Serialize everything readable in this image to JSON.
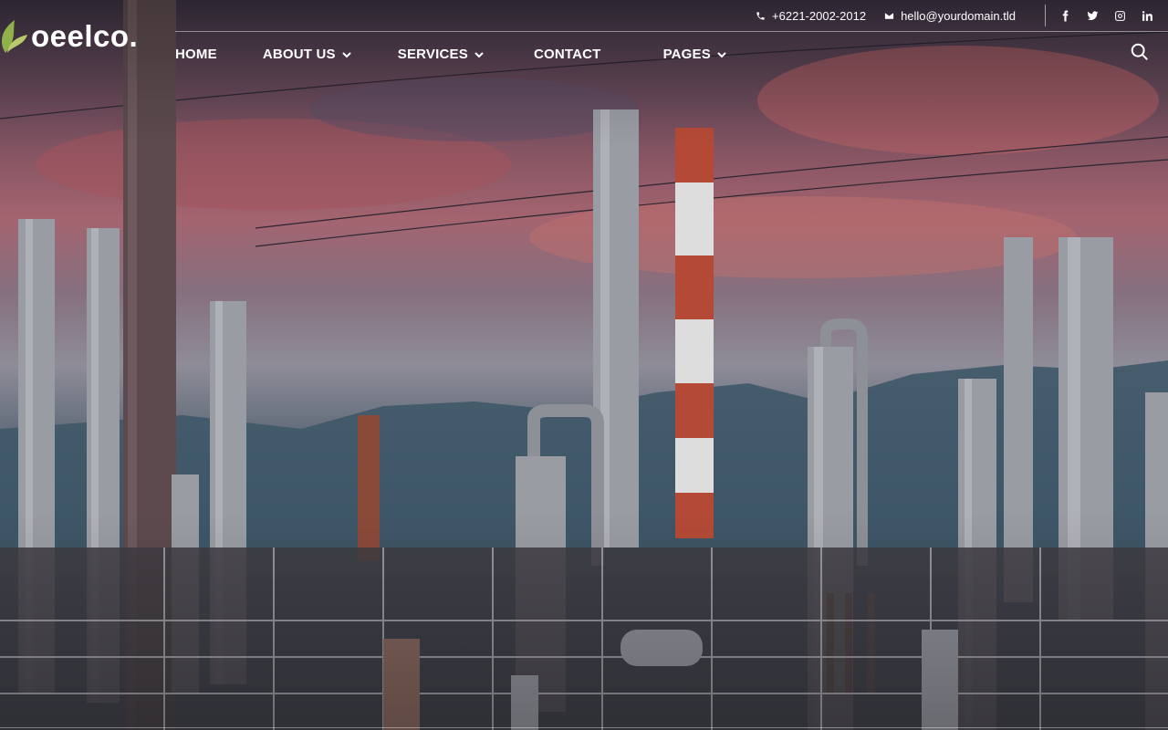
{
  "brand": {
    "name": "oeelco.",
    "accent": "#8fb04a"
  },
  "topbar": {
    "phone": "+6221-2002-2012",
    "email": "hello@yourdomain.tld",
    "social": [
      "facebook-icon",
      "twitter-icon",
      "instagram-icon",
      "linkedin-icon"
    ]
  },
  "nav": {
    "items": [
      {
        "label": "HOME",
        "has_dropdown": false
      },
      {
        "label": "ABOUT US",
        "has_dropdown": true
      },
      {
        "label": "SERVICES",
        "has_dropdown": true
      },
      {
        "label": "CONTACT",
        "has_dropdown": false
      },
      {
        "label": "PAGES",
        "has_dropdown": true
      }
    ]
  },
  "hero": {
    "image": "industrial-refinery-at-sunset"
  }
}
